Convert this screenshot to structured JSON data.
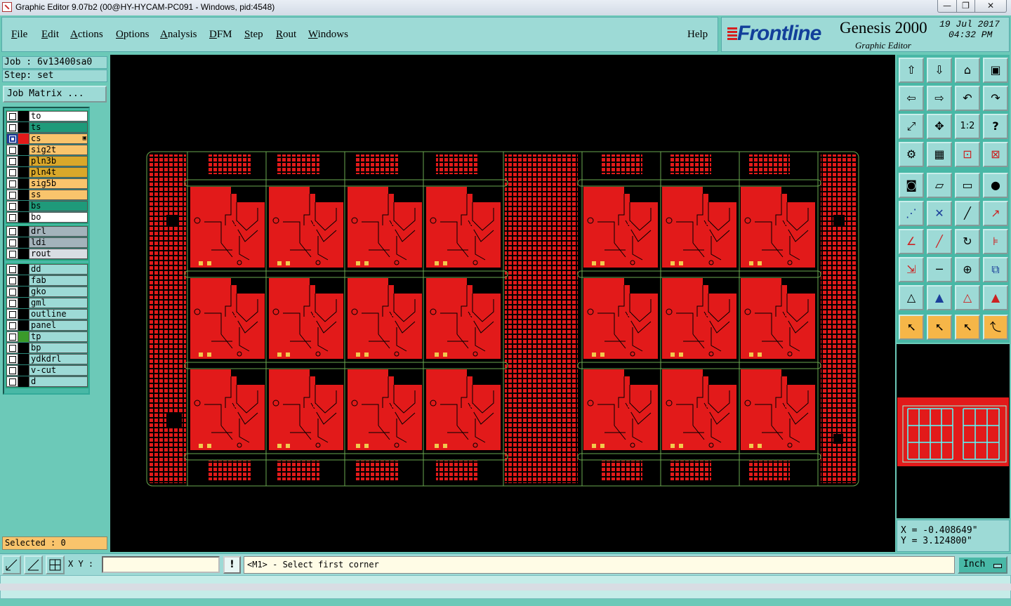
{
  "window": {
    "title": "Graphic Editor 9.07b2 (00@HY-HYCAM-PC091 - Windows, pid:4548)",
    "min_label": "—",
    "max_label": "❐",
    "close_label": "✕"
  },
  "menu": {
    "items": [
      {
        "u": "F",
        "rest": "ile"
      },
      {
        "u": "E",
        "rest": "dit"
      },
      {
        "u": "A",
        "rest": "ctions"
      },
      {
        "u": "O",
        "rest": "ptions"
      },
      {
        "u": "A",
        "rest": "nalysis"
      },
      {
        "u": "D",
        "rest": "FM"
      },
      {
        "u": "S",
        "rest": "tep"
      },
      {
        "u": "R",
        "rest": "out"
      },
      {
        "u": "W",
        "rest": "indows"
      }
    ],
    "help": "Help"
  },
  "brand": {
    "logo": "Frontline",
    "product": "Genesis 2000",
    "subtitle": "Graphic Editor",
    "date": "19 Jul 2017",
    "time": "04:32 PM"
  },
  "info": {
    "job": "Job : 6v13400sa0",
    "step": "Step: set",
    "job_matrix": "Job Matrix ..."
  },
  "layers": {
    "board": [
      {
        "name": "to",
        "bg": "#ffffff",
        "marker": "#000000",
        "selected": false
      },
      {
        "name": "ts",
        "bg": "#1f9a7a",
        "marker": "#000000",
        "selected": false
      },
      {
        "name": "cs",
        "bg": "#f9c46c",
        "marker": "#e21a1a",
        "selected": true
      },
      {
        "name": "sig2t",
        "bg": "#f9c46c",
        "marker": "#000000",
        "selected": false
      },
      {
        "name": "pln3b",
        "bg": "#d9a82a",
        "marker": "#000000",
        "selected": false
      },
      {
        "name": "pln4t",
        "bg": "#d9a82a",
        "marker": "#000000",
        "selected": false
      },
      {
        "name": "sig5b",
        "bg": "#f9c46c",
        "marker": "#000000",
        "selected": false
      },
      {
        "name": "ss",
        "bg": "#f9c46c",
        "marker": "#000000",
        "selected": false
      },
      {
        "name": "bs",
        "bg": "#1f9a7a",
        "marker": "#000000",
        "selected": false
      },
      {
        "name": "bo",
        "bg": "#ffffff",
        "marker": "#000000",
        "selected": false
      }
    ],
    "drill": [
      {
        "name": "drl",
        "bg": "#a3b3bb",
        "marker": "#000000"
      },
      {
        "name": "ldi",
        "bg": "#a3b3bb",
        "marker": "#000000"
      },
      {
        "name": "rout",
        "bg": "#d8dde3",
        "marker": "#000000"
      }
    ],
    "misc": [
      {
        "name": "dd",
        "bg": "#9ddad6",
        "marker": "#000000"
      },
      {
        "name": "fab",
        "bg": "#9ddad6",
        "marker": "#000000"
      },
      {
        "name": "gko",
        "bg": "#9ddad6",
        "marker": "#000000"
      },
      {
        "name": "gml",
        "bg": "#9ddad6",
        "marker": "#000000"
      },
      {
        "name": "outline",
        "bg": "#9ddad6",
        "marker": "#000000"
      },
      {
        "name": "panel",
        "bg": "#9ddad6",
        "marker": "#000000"
      },
      {
        "name": "tp",
        "bg": "#9ddad6",
        "marker": "#3a9a2a"
      },
      {
        "name": "bp",
        "bg": "#9ddad6",
        "marker": "#000000"
      },
      {
        "name": "ydkdrl",
        "bg": "#9ddad6",
        "marker": "#000000"
      },
      {
        "name": "v-cut",
        "bg": "#9ddad6",
        "marker": "#000000"
      },
      {
        "name": "d",
        "bg": "#9ddad6",
        "marker": "#000000"
      }
    ]
  },
  "selected": "Selected : 0",
  "tools": [
    [
      "up-layer-icon",
      "down-layer-icon",
      "home-icon",
      "window-icon"
    ],
    [
      "left-icon",
      "right-icon",
      "undo-icon",
      "redo-icon"
    ],
    [
      "zoom-fit-icon",
      "zoom-center-icon",
      "scale-1-2-icon",
      "help-icon"
    ],
    [
      "tools-icon",
      "grid-icon",
      "snap-a-icon",
      "snap-b-icon"
    ],
    [
      "select-box-icon",
      "draw-poly-icon",
      "ruler-icon",
      "pad-icon"
    ],
    [
      "connect-icon",
      "delete-icon",
      "line-icon",
      "line-arrow-icon"
    ],
    [
      "angle-icon",
      "arc-line-icon",
      "rotate-icon",
      "feature-icon"
    ],
    [
      "move-icon",
      "measure-icon",
      "center-icon",
      "copy-icon"
    ],
    [
      "triangle-a-icon",
      "triangle-b-icon",
      "triangle-c-icon",
      "triangle-d-icon"
    ],
    [
      "pointer-icon",
      "pointer-box-icon",
      "pointer-circle-icon",
      "pointer-path-icon"
    ]
  ],
  "tool_glyphs": {
    "scale": "1:2",
    "help": "?"
  },
  "coords": {
    "x": "X = -0.408649\"",
    "y": "Y = 3.124800\""
  },
  "bottom": {
    "xy_label": "X Y :",
    "xy_value": "",
    "excl": "!",
    "prompt": "<M1> - Select first corner",
    "units": "Inch"
  },
  "colors": {
    "panel": "#9ddad6",
    "board_red": "#e21a1a",
    "outline_green": "#6aa84f",
    "accent_orange": "#f6b648"
  }
}
